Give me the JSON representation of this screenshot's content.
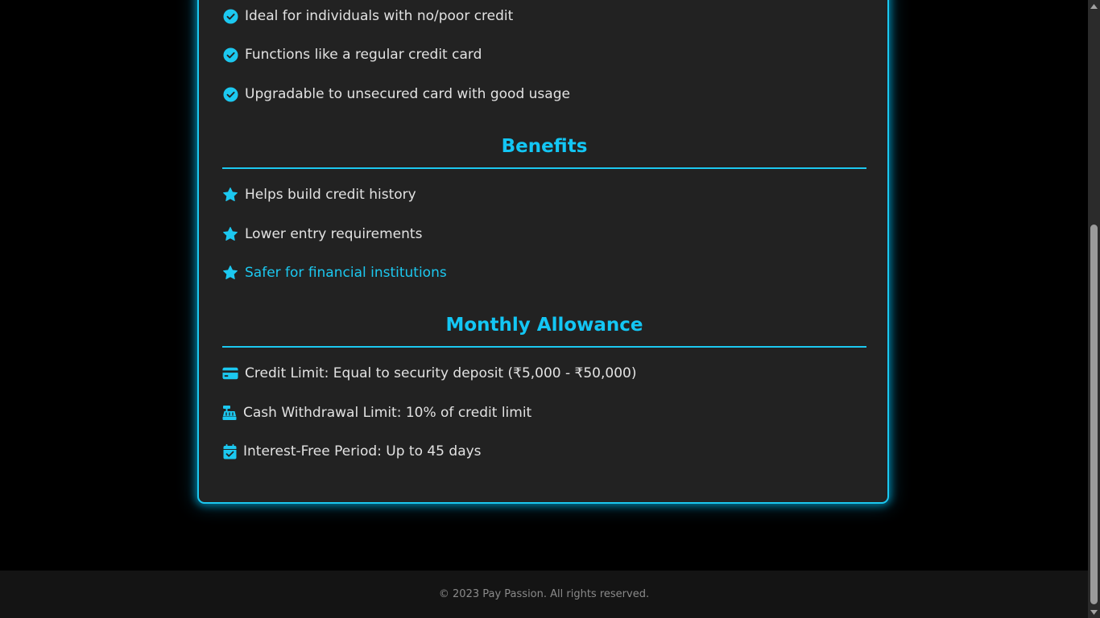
{
  "features": [
    {
      "text": "Ideal for individuals with no/poor credit",
      "icon": "check-circle-icon"
    },
    {
      "text": "Functions like a regular credit card",
      "icon": "check-circle-icon"
    },
    {
      "text": "Upgradable to unsecured card with good usage",
      "icon": "check-circle-icon"
    }
  ],
  "benefits": {
    "title": "Benefits",
    "items": [
      {
        "text": "Helps build credit history",
        "icon": "star-icon"
      },
      {
        "text": "Lower entry requirements",
        "icon": "star-icon"
      },
      {
        "text": "Safer for financial institutions",
        "icon": "star-icon"
      }
    ]
  },
  "allowance": {
    "title": "Monthly Allowance",
    "items": [
      {
        "text": "Credit Limit: Equal to security deposit (₹5,000 - ₹50,000)",
        "icon": "credit-card-icon"
      },
      {
        "text": "Cash Withdrawal Limit: 10% of credit limit",
        "icon": "cash-register-icon"
      },
      {
        "text": "Interest-Free Period: Up to 45 days",
        "icon": "calendar-check-icon"
      }
    ]
  },
  "footer": {
    "text": "© 2023 Pay Passion. All rights reserved."
  },
  "colors": {
    "accent": "#1cc8f0",
    "card_bg": "#222222",
    "page_bg": "#000000",
    "footer_bg": "#141414"
  }
}
